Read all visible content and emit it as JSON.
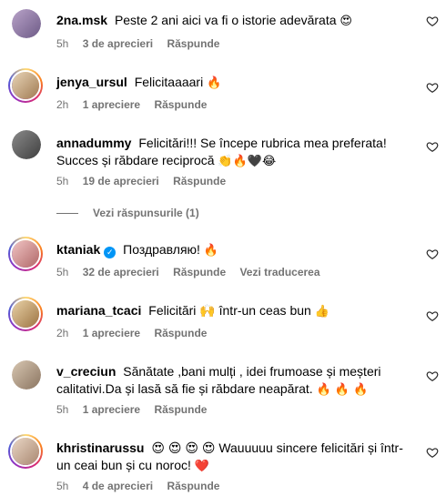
{
  "comments": [
    {
      "username": "2na.msk",
      "text": "Peste 2 ani aici va fi o istorie adevărata",
      "emoji": "😍",
      "time": "5h",
      "likes": "3 de aprecieri",
      "reply": "Răspunde"
    },
    {
      "username": "jenya_ursul",
      "text": "Felicitaaaari",
      "emoji": "🔥",
      "time": "2h",
      "likes": "1 apreciere",
      "reply": "Răspunde"
    },
    {
      "username": "annadummy",
      "text": "Felicitări!!! Se începe rubrica mea preferata! Succes și răbdare reciprocă",
      "emoji": "👏🔥🖤😂",
      "time": "5h",
      "likes": "19 de aprecieri",
      "reply": "Răspunde",
      "view_replies": "Vezi răspunsurile (1)"
    },
    {
      "username": "ktaniak",
      "text": "Поздравляю!",
      "emoji": "🔥",
      "time": "5h",
      "likes": "32 de aprecieri",
      "reply": "Răspunde",
      "translate": "Vezi traducerea"
    },
    {
      "username": "mariana_tcaci",
      "text": "Felicitări 🙌 într-un ceas bun",
      "emoji": "👍",
      "time": "2h",
      "likes": "1 apreciere",
      "reply": "Răspunde"
    },
    {
      "username": "v_creciun",
      "text": "Sănătate ,bani mulți , idei frumoase și meșteri calitativi.Da și lasă să fie și răbdare neapărat.",
      "emoji": "🔥 🔥 🔥",
      "time": "5h",
      "likes": "1 apreciere",
      "reply": "Răspunde"
    },
    {
      "username": "khristinarussu",
      "text": "😍 😍 😍 😍 Wauuuuu sincere felicitări și într-un ceai bun și cu noroc!",
      "emoji": "❤️",
      "time": "5h",
      "likes": "4 de aprecieri",
      "reply": "Răspunde"
    }
  ],
  "icons": {
    "like": "heart-outline-icon",
    "verified": "verified-badge-icon"
  },
  "colors": {
    "meta": "#737373",
    "verified": "#0095f6"
  }
}
